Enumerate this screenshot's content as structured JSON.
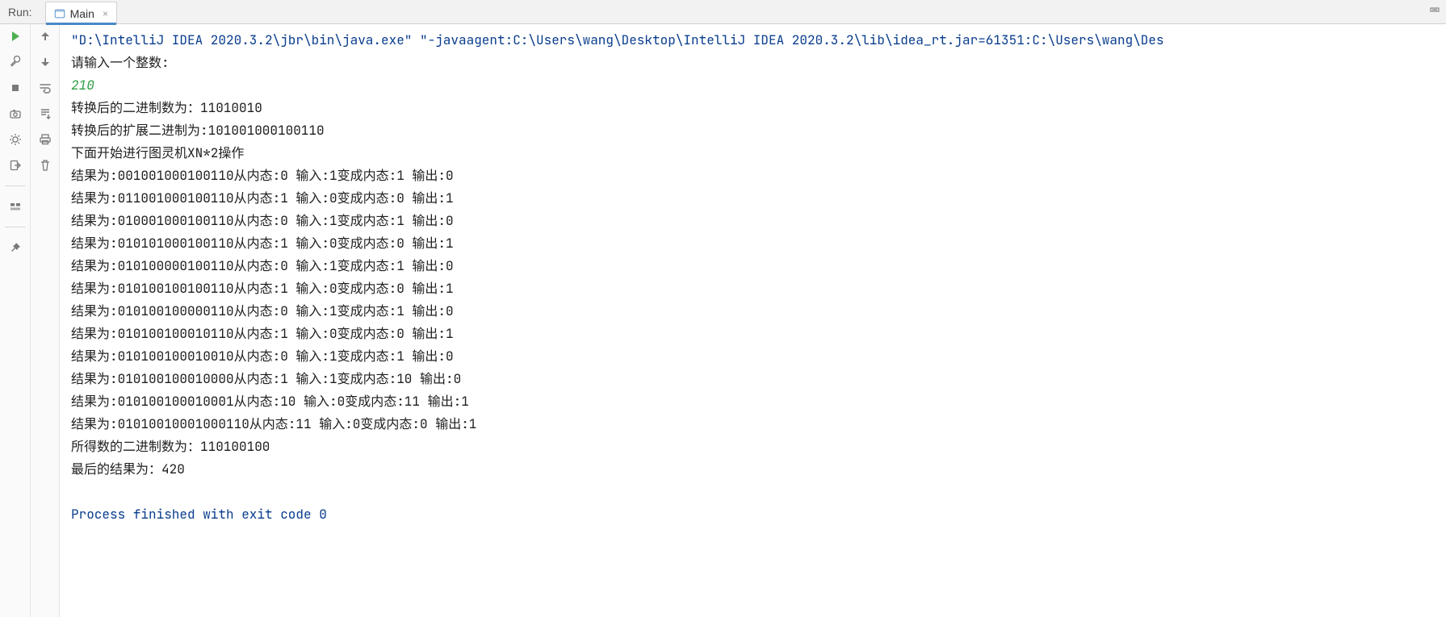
{
  "header": {
    "run_label": "Run:",
    "tab_label": "Main",
    "tab_close_glyph": "×"
  },
  "gutter_left": {
    "icons": [
      "play-icon",
      "wrench-icon",
      "stop-icon",
      "camera-icon",
      "bug-gear-icon",
      "exit-icon"
    ],
    "after_sep_icons": [
      "layout-icon"
    ],
    "after_sep2_icons": [
      "pin-icon"
    ]
  },
  "gutter_right": {
    "icons": [
      "up-arrow-icon",
      "down-arrow-icon",
      "wrap-icon",
      "scroll-end-icon",
      "print-icon",
      "trash-icon"
    ]
  },
  "console": {
    "lines": [
      {
        "cls": "c-blue",
        "text": "\"D:\\IntelliJ IDEA 2020.3.2\\jbr\\bin\\java.exe\" \"-javaagent:C:\\Users\\wang\\Desktop\\IntelliJ IDEA 2020.3.2\\lib\\idea_rt.jar=61351:C:\\Users\\wang\\Des"
      },
      {
        "cls": "",
        "text": "请输入一个整数:"
      },
      {
        "cls": "c-green",
        "text": "210"
      },
      {
        "cls": "",
        "text": "转换后的二进制数为：11010010"
      },
      {
        "cls": "",
        "text": "转换后的扩展二进制为:101001000100110"
      },
      {
        "cls": "",
        "text": "下面开始进行图灵机XN*2操作"
      },
      {
        "cls": "",
        "text": "结果为:001001000100110从内态:0 输入:1变成内态:1 输出:0"
      },
      {
        "cls": "",
        "text": "结果为:011001000100110从内态:1 输入:0变成内态:0 输出:1"
      },
      {
        "cls": "",
        "text": "结果为:010001000100110从内态:0 输入:1变成内态:1 输出:0"
      },
      {
        "cls": "",
        "text": "结果为:010101000100110从内态:1 输入:0变成内态:0 输出:1"
      },
      {
        "cls": "",
        "text": "结果为:010100000100110从内态:0 输入:1变成内态:1 输出:0"
      },
      {
        "cls": "",
        "text": "结果为:010100100100110从内态:1 输入:0变成内态:0 输出:1"
      },
      {
        "cls": "",
        "text": "结果为:010100100000110从内态:0 输入:1变成内态:1 输出:0"
      },
      {
        "cls": "",
        "text": "结果为:010100100010110从内态:1 输入:0变成内态:0 输出:1"
      },
      {
        "cls": "",
        "text": "结果为:010100100010010从内态:0 输入:1变成内态:1 输出:0"
      },
      {
        "cls": "",
        "text": "结果为:010100100010000从内态:1 输入:1变成内态:10 输出:0"
      },
      {
        "cls": "",
        "text": "结果为:010100100010001从内态:10 输入:0变成内态:11 输出:1"
      },
      {
        "cls": "",
        "text": "结果为:01010010001000110从内态:11 输入:0变成内态:0 输出:1"
      },
      {
        "cls": "",
        "text": "所得数的二进制数为：110100100"
      },
      {
        "cls": "",
        "text": "最后的结果为：420"
      },
      {
        "cls": "blank",
        "text": ""
      },
      {
        "cls": "c-blue",
        "text": "Process finished with exit code 0"
      }
    ]
  },
  "top_right_icon": "settings-hide-icon"
}
